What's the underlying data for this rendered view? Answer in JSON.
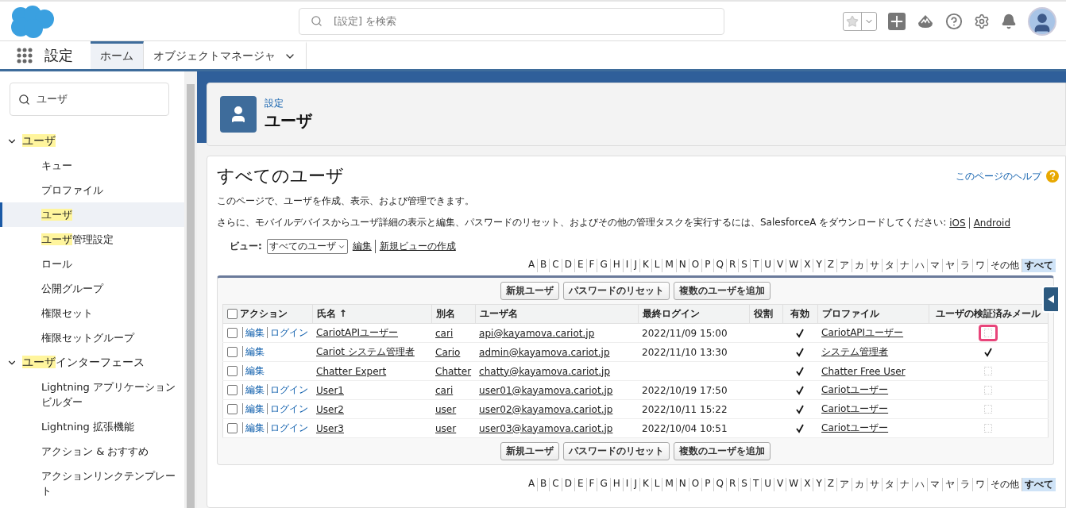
{
  "header": {
    "search": {
      "placeholder": "[設定] を検索"
    }
  },
  "nav": {
    "app_name": "設定",
    "tabs": [
      {
        "label": "ホーム",
        "selected": true,
        "dropdown": false
      },
      {
        "label": "オブジェクトマネージャ",
        "selected": false,
        "dropdown": true
      }
    ]
  },
  "sidebar": {
    "search": {
      "value": "ユーザ"
    },
    "tree": [
      {
        "match": "ユーザ",
        "expanded": true,
        "children": [
          {
            "label": "キュー",
            "selected": false
          },
          {
            "label": "プロファイル",
            "selected": false
          },
          {
            "match": "ユーザ",
            "selected": true
          },
          {
            "match": "ユーザ",
            "label": "管理設定",
            "selected": false
          },
          {
            "label": "ロール",
            "selected": false
          },
          {
            "label": "公開グループ",
            "selected": false
          },
          {
            "label": "権限セット",
            "selected": false
          },
          {
            "label": "権限セットグループ",
            "selected": false
          }
        ]
      },
      {
        "match": "ユーザ",
        "label": "インターフェース",
        "expanded": true,
        "children": [
          {
            "label": "Lightning アプリケーションビルダー",
            "selected": false
          },
          {
            "label": "Lightning 拡張機能",
            "selected": false
          },
          {
            "label": "アクション & おすすめ",
            "selected": false
          },
          {
            "label": "アクションリンクテンプレート",
            "selected": false
          }
        ]
      }
    ]
  },
  "page_header": {
    "breadcrumb": "設定",
    "title": "ユーザ"
  },
  "content": {
    "title": "すべてのユーザ",
    "help_link": "このページのヘルプ",
    "description": "このページで、ユーザを作成、表示、および管理できます。",
    "mobile_note": "さらに、モバイルデバイスからユーザ詳細の表示と編集、パスワードのリセット、およびその他の管理タスクを実行するには、SalesforceA をダウンロードしてください:",
    "mobile_links": [
      "iOS",
      "Android"
    ],
    "view": {
      "label": "ビュー:",
      "value": "すべてのユーザ",
      "links": [
        "編集",
        "新規ビューの作成"
      ]
    },
    "alphabet_top": [
      {
        "label": "A",
        "selected": false
      },
      {
        "label": "B",
        "selected": false
      },
      {
        "label": "C",
        "selected": false
      },
      {
        "label": "D",
        "selected": false
      },
      {
        "label": "E",
        "selected": false
      },
      {
        "label": "F",
        "selected": false
      },
      {
        "label": "G",
        "selected": false
      },
      {
        "label": "H",
        "selected": false
      },
      {
        "label": "I",
        "selected": false
      },
      {
        "label": "J",
        "selected": false
      },
      {
        "label": "K",
        "selected": false
      },
      {
        "label": "L",
        "selected": false
      },
      {
        "label": "M",
        "selected": false
      },
      {
        "label": "N",
        "selected": false
      },
      {
        "label": "O",
        "selected": false
      },
      {
        "label": "P",
        "selected": false
      },
      {
        "label": "Q",
        "selected": false
      },
      {
        "label": "R",
        "selected": false
      },
      {
        "label": "S",
        "selected": false
      },
      {
        "label": "T",
        "selected": false
      },
      {
        "label": "U",
        "selected": false
      },
      {
        "label": "V",
        "selected": false
      },
      {
        "label": "W",
        "selected": false
      },
      {
        "label": "X",
        "selected": false
      },
      {
        "label": "Y",
        "selected": false
      },
      {
        "label": "Z",
        "selected": false
      },
      {
        "label": "ア",
        "selected": false
      },
      {
        "label": "カ",
        "selected": false
      },
      {
        "label": "サ",
        "selected": false
      },
      {
        "label": "タ",
        "selected": false
      },
      {
        "label": "ナ",
        "selected": false
      },
      {
        "label": "ハ",
        "selected": false
      },
      {
        "label": "マ",
        "selected": false
      },
      {
        "label": "ヤ",
        "selected": false
      },
      {
        "label": "ラ",
        "selected": false
      },
      {
        "label": "ワ",
        "selected": false
      },
      {
        "label": "その他",
        "selected": false
      },
      {
        "label": "すべて",
        "selected": true
      }
    ],
    "buttons_top": [
      "新規ユーザ",
      "パスワードのリセット",
      "複数のユーザを追加"
    ],
    "table": {
      "select_all_checked": false,
      "columns": [
        "アクション",
        "氏名",
        "別名",
        "ユーザ名",
        "最終ログイン",
        "役割",
        "有効",
        "プロファイル",
        "ユーザの検証済みメール"
      ],
      "sort_indicator": "↑",
      "rows": [
        {
          "checked": false,
          "actions": [
            "編集",
            "ログイン"
          ],
          "name": "CariotAPIユーザー",
          "alias": "cari",
          "username": "api@kayamova.cariot.jp",
          "last_login": "2022/11/09 15:00",
          "active": true,
          "profile": "CariotAPIユーザー",
          "verified": false,
          "highlighted": true
        },
        {
          "checked": false,
          "actions": [
            "編集"
          ],
          "name": "Cariot システム管理者",
          "alias": "Cario",
          "username": "admin@kayamova.cariot.jp",
          "last_login": "2022/11/10 13:30",
          "active": true,
          "profile": "システム管理者",
          "verified": true,
          "highlighted": false
        },
        {
          "checked": false,
          "actions": [
            "編集"
          ],
          "name": "Chatter Expert",
          "alias": "Chatter",
          "username": "chatty@kayamova.cariot.jp",
          "active": true,
          "profile": "Chatter Free User",
          "verified": false,
          "highlighted": false
        },
        {
          "checked": false,
          "actions": [
            "編集",
            "ログイン"
          ],
          "name": "User1",
          "alias": "cari",
          "username": "user01@kayamova.cariot.jp",
          "last_login": "2022/10/19 17:50",
          "active": true,
          "profile": "Cariotユーザー",
          "verified": false,
          "highlighted": false
        },
        {
          "checked": false,
          "actions": [
            "編集",
            "ログイン"
          ],
          "name": "User2",
          "alias": "user",
          "username": "user02@kayamova.cariot.jp",
          "last_login": "2022/10/11 15:22",
          "active": true,
          "profile": "Cariotユーザー",
          "verified": false,
          "highlighted": false
        },
        {
          "checked": false,
          "actions": [
            "編集",
            "ログイン"
          ],
          "name": "User3",
          "alias": "user",
          "username": "user03@kayamova.cariot.jp",
          "last_login": "2022/10/04 10:51",
          "active": true,
          "profile": "Cariotユーザー",
          "verified": false,
          "highlighted": false
        }
      ]
    },
    "buttons_bottom": [
      "新規ユーザ",
      "パスワードのリセット",
      "複数のユーザを追加"
    ],
    "alphabet_bottom": [
      {
        "label": "A",
        "selected": false
      },
      {
        "label": "B",
        "selected": false
      },
      {
        "label": "C",
        "selected": false
      },
      {
        "label": "D",
        "selected": false
      },
      {
        "label": "E",
        "selected": false
      },
      {
        "label": "F",
        "selected": false
      },
      {
        "label": "G",
        "selected": false
      },
      {
        "label": "H",
        "selected": false
      },
      {
        "label": "I",
        "selected": false
      },
      {
        "label": "J",
        "selected": false
      },
      {
        "label": "K",
        "selected": false
      },
      {
        "label": "L",
        "selected": false
      },
      {
        "label": "M",
        "selected": false
      },
      {
        "label": "N",
        "selected": false
      },
      {
        "label": "O",
        "selected": false
      },
      {
        "label": "P",
        "selected": false
      },
      {
        "label": "Q",
        "selected": false
      },
      {
        "label": "R",
        "selected": false
      },
      {
        "label": "S",
        "selected": false
      },
      {
        "label": "T",
        "selected": false
      },
      {
        "label": "U",
        "selected": false
      },
      {
        "label": "V",
        "selected": false
      },
      {
        "label": "W",
        "selected": false
      },
      {
        "label": "X",
        "selected": false
      },
      {
        "label": "Y",
        "selected": false
      },
      {
        "label": "Z",
        "selected": false
      },
      {
        "label": "ア",
        "selected": false
      },
      {
        "label": "カ",
        "selected": false
      },
      {
        "label": "サ",
        "selected": false
      },
      {
        "label": "タ",
        "selected": false
      },
      {
        "label": "ナ",
        "selected": false
      },
      {
        "label": "ハ",
        "selected": false
      },
      {
        "label": "マ",
        "selected": false
      },
      {
        "label": "ヤ",
        "selected": false
      },
      {
        "label": "ラ",
        "selected": false
      },
      {
        "label": "ワ",
        "selected": false
      },
      {
        "label": "その他",
        "selected": false
      },
      {
        "label": "すべて",
        "selected": true
      }
    ]
  }
}
